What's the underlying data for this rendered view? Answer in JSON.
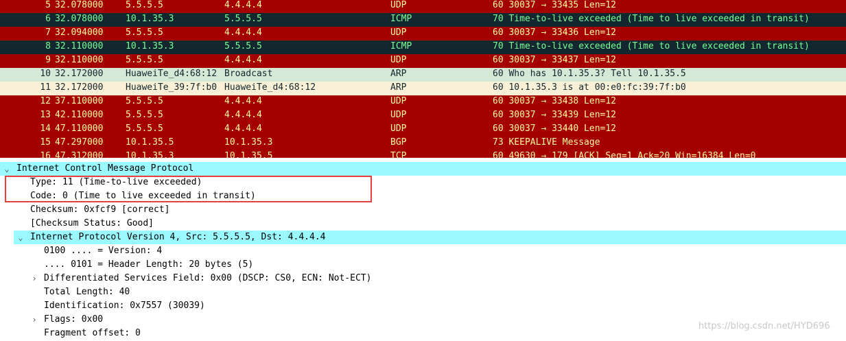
{
  "packet_list": {
    "rows": [
      {
        "no": "5",
        "time": "32.078000",
        "src": "5.5.5.5",
        "dst": "4.4.4.4",
        "proto": "UDP",
        "info": "60 30037 → 33435 Len=12",
        "style": "udp"
      },
      {
        "no": "6",
        "time": "32.078000",
        "src": "10.1.35.3",
        "dst": "5.5.5.5",
        "proto": "ICMP",
        "info": "70 Time-to-live exceeded (Time to live exceeded in transit)",
        "style": "icmp"
      },
      {
        "no": "7",
        "time": "32.094000",
        "src": "5.5.5.5",
        "dst": "4.4.4.4",
        "proto": "UDP",
        "info": "60 30037 → 33436 Len=12",
        "style": "udp"
      },
      {
        "no": "8",
        "time": "32.110000",
        "src": "10.1.35.3",
        "dst": "5.5.5.5",
        "proto": "ICMP",
        "info": "70 Time-to-live exceeded (Time to live exceeded in transit)",
        "style": "icmp"
      },
      {
        "no": "9",
        "time": "32.110000",
        "src": "5.5.5.5",
        "dst": "4.4.4.4",
        "proto": "UDP",
        "info": "60 30037 → 33437 Len=12",
        "style": "udp"
      },
      {
        "no": "10",
        "time": "32.172000",
        "src": "HuaweiTe_d4:68:12",
        "dst": "Broadcast",
        "proto": "ARP",
        "info": "60 Who has 10.1.35.3? Tell 10.1.35.5",
        "style": "arp1"
      },
      {
        "no": "11",
        "time": "32.172000",
        "src": "HuaweiTe_39:7f:b0",
        "dst": "HuaweiTe_d4:68:12",
        "proto": "ARP",
        "info": "60 10.1.35.3 is at 00:e0:fc:39:7f:b0",
        "style": "arp2"
      },
      {
        "no": "12",
        "time": "37.110000",
        "src": "5.5.5.5",
        "dst": "4.4.4.4",
        "proto": "UDP",
        "info": "60 30037 → 33438 Len=12",
        "style": "udp"
      },
      {
        "no": "13",
        "time": "42.110000",
        "src": "5.5.5.5",
        "dst": "4.4.4.4",
        "proto": "UDP",
        "info": "60 30037 → 33439 Len=12",
        "style": "udp"
      },
      {
        "no": "14",
        "time": "47.110000",
        "src": "5.5.5.5",
        "dst": "4.4.4.4",
        "proto": "UDP",
        "info": "60 30037 → 33440 Len=12",
        "style": "udp"
      },
      {
        "no": "15",
        "time": "47.297000",
        "src": "10.1.35.5",
        "dst": "10.1.35.3",
        "proto": "BGP",
        "info": "73 KEEPALIVE Message",
        "style": "bgp"
      },
      {
        "no": "16",
        "time": "47.312000",
        "src": "10.1.35.3",
        "dst": "10.1.35.5",
        "proto": "TCP",
        "info": "60 49630 → 179 [ACK] Seq=1 Ack=20 Win=16384 Len=0",
        "style": "tcp"
      }
    ]
  },
  "detail": {
    "icmp_header": "Internet Control Message Protocol",
    "type": "Type: 11 (Time-to-live exceeded)",
    "code": "Code: 0 (Time to live exceeded in transit)",
    "checksum": "Checksum: 0xfcf9 [correct]",
    "checksum_status": "[Checksum Status: Good]",
    "ip_header": "Internet Protocol Version 4, Src: 5.5.5.5, Dst: 4.4.4.4",
    "version": "0100 .... = Version: 4",
    "header_length": ".... 0101 = Header Length: 20 bytes (5)",
    "dsfield": "Differentiated Services Field: 0x00 (DSCP: CS0, ECN: Not-ECT)",
    "total_length": "Total Length: 40",
    "identification": "Identification: 0x7557 (30039)",
    "flags": "Flags: 0x00",
    "fragment_offset": "Fragment offset: 0"
  },
  "icons": {
    "expanded": "chevron-down-icon",
    "collapsed": "chevron-right-icon"
  },
  "watermark": "https://blog.csdn.net/HYD696"
}
